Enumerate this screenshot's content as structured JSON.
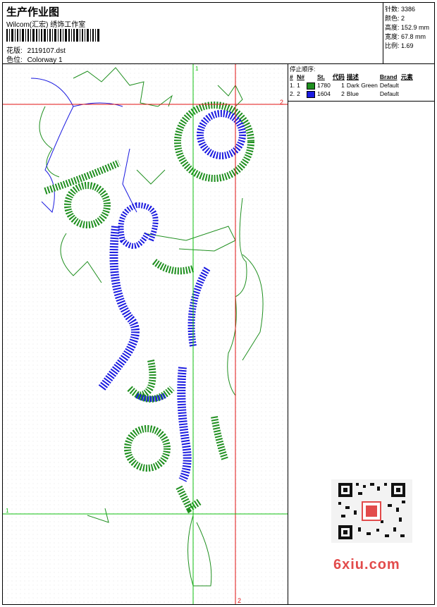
{
  "header": {
    "title": "生产作业图",
    "company": "Wilcom(汇宏) 绣饰工作室",
    "design_label": "花版:",
    "design_value": "2119107.dst",
    "colorway_label": "色位:",
    "colorway_value": "Colorway 1"
  },
  "stats": [
    {
      "label": "针数:",
      "value": "3386"
    },
    {
      "label": "颜色:",
      "value": "2"
    },
    {
      "label": "高度:",
      "value": "152.9 mm"
    },
    {
      "label": "宽度:",
      "value": "67.8 mm"
    },
    {
      "label": "比例:",
      "value": "1.69"
    }
  ],
  "stop_sequence": {
    "title": "停止顺序:",
    "columns": [
      "#",
      "N#",
      "St.",
      "代码",
      "描述",
      "Brand",
      "元素"
    ],
    "rows": [
      {
        "num": "1.",
        "n": "1",
        "color": "#1f8f1f",
        "st": "1780",
        "code": "1",
        "desc": "Dark Green",
        "brand": "Default"
      },
      {
        "num": "2.",
        "n": "2",
        "color": "#1a1ae0",
        "st": "1604",
        "code": "2",
        "desc": "Blue",
        "brand": "Default"
      }
    ]
  },
  "guides": {
    "v_green_label": "1",
    "v_red_label": "2",
    "h_red_label": "2",
    "h_green_label": "1"
  },
  "watermark": "6xiu.com",
  "colors": {
    "green": "#1f8f1f",
    "blue": "#1a1ae0",
    "guide_red": "#e01010",
    "guide_green": "#10c010"
  }
}
